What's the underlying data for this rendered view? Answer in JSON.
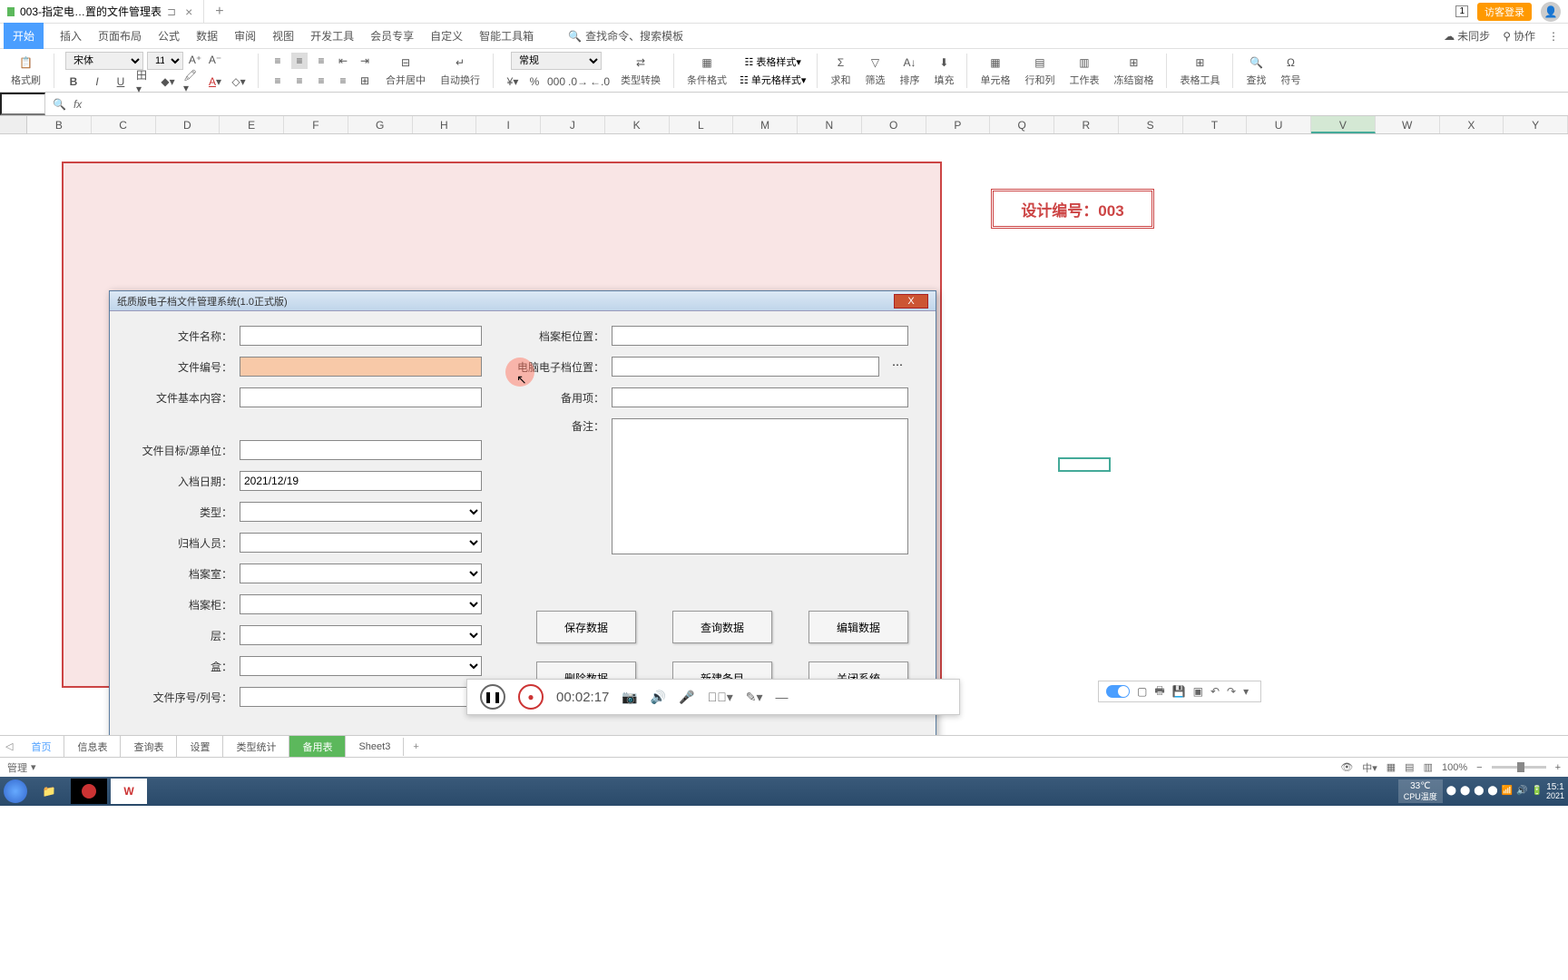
{
  "tab": {
    "title": "003-指定电…置的文件管理表",
    "pinned": "⊐"
  },
  "login": "访客登录",
  "menu": {
    "items": [
      "开始",
      "插入",
      "页面布局",
      "公式",
      "数据",
      "审阅",
      "视图",
      "开发工具",
      "会员专享",
      "自定义",
      "智能工具箱"
    ],
    "search_placeholder": "查找命令、搜索模板",
    "sync": "未同步",
    "collab": "协作"
  },
  "ribbon": {
    "paste": "格式刷",
    "font": "宋体",
    "size": "11",
    "merge": "合并居中",
    "wrap": "自动换行",
    "numfmt": "常规",
    "typetrans": "类型转换",
    "cond": "条件格式",
    "tblfmt": "表格样式",
    "cellfmt": "单元格样式",
    "sum": "求和",
    "filter": "筛选",
    "sort": "排序",
    "fill": "填充",
    "cell": "单元格",
    "rowcol": "行和列",
    "sheet": "工作表",
    "freeze": "冻结窗格",
    "tbltool": "表格工具",
    "find": "查找",
    "symbol": "符号"
  },
  "columns": [
    "B",
    "C",
    "D",
    "E",
    "F",
    "G",
    "H",
    "I",
    "J",
    "K",
    "L",
    "M",
    "N",
    "O",
    "P",
    "Q",
    "R",
    "S",
    "T",
    "U",
    "V",
    "W",
    "X",
    "Y"
  ],
  "sel_col": "V",
  "badge": "设计编号：003",
  "dialog": {
    "title": "纸质版电子档文件管理系统(1.0正式版)",
    "labels": {
      "filename": "文件名称：",
      "fileno": "文件编号：",
      "content": "文件基本内容：",
      "target": "文件目标/源单位：",
      "date": "入档日期：",
      "type": "类型：",
      "person": "归档人员：",
      "room": "档案室：",
      "cabinet": "档案柜：",
      "layer": "层：",
      "box": "盒：",
      "seq": "文件序号/列号：",
      "loc": "档案柜位置：",
      "eloc": "电脑电子档位置：",
      "spare": "备用项：",
      "remark": "备注："
    },
    "date_val": "2021/12/19",
    "btns": {
      "save": "保存数据",
      "query": "查询数据",
      "edit": "编辑数据",
      "delete": "删除数据",
      "new": "新建条目",
      "close": "关闭系统"
    }
  },
  "rec_time": "00:02:17",
  "sheets": [
    "首页",
    "信息表",
    "查询表",
    "设置",
    "类型统计",
    "备用表",
    "Sheet3"
  ],
  "active_sheet": "备用表",
  "status_left": "管理",
  "zoom": "100%",
  "temp": "33℃",
  "cpu": "CPU温度",
  "clock": "15:1",
  "year": "2021"
}
